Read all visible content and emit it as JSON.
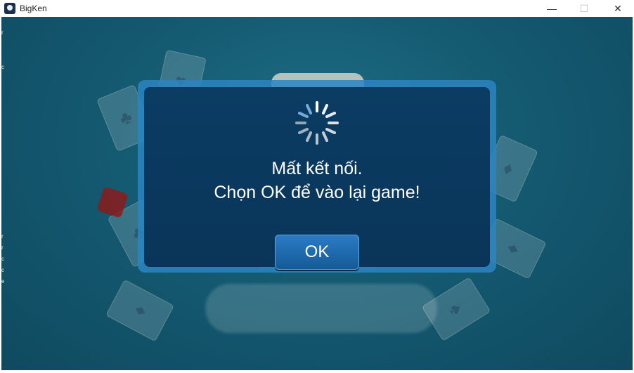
{
  "window": {
    "title": "BigKen",
    "minimize_glyph": "—",
    "maximize_glyph": "☐",
    "close_glyph": "✕"
  },
  "edge_fragments": [
    "r",
    "c",
    "r",
    "r",
    "c",
    "c",
    "e"
  ],
  "dialog": {
    "line1": "Mất kết nối.",
    "line2": "Chọn OK để vào lại game!",
    "ok_label": "OK"
  },
  "colors": {
    "background": "#145a71",
    "dialog_bg": "#0b3c63",
    "dialog_border": "#2a85c2",
    "ok_button": "#2b7bc5",
    "text": "#ffffff"
  },
  "icons": [
    "app-icon",
    "loading-spinner-icon",
    "minimize-icon",
    "maximize-icon",
    "close-icon"
  ]
}
